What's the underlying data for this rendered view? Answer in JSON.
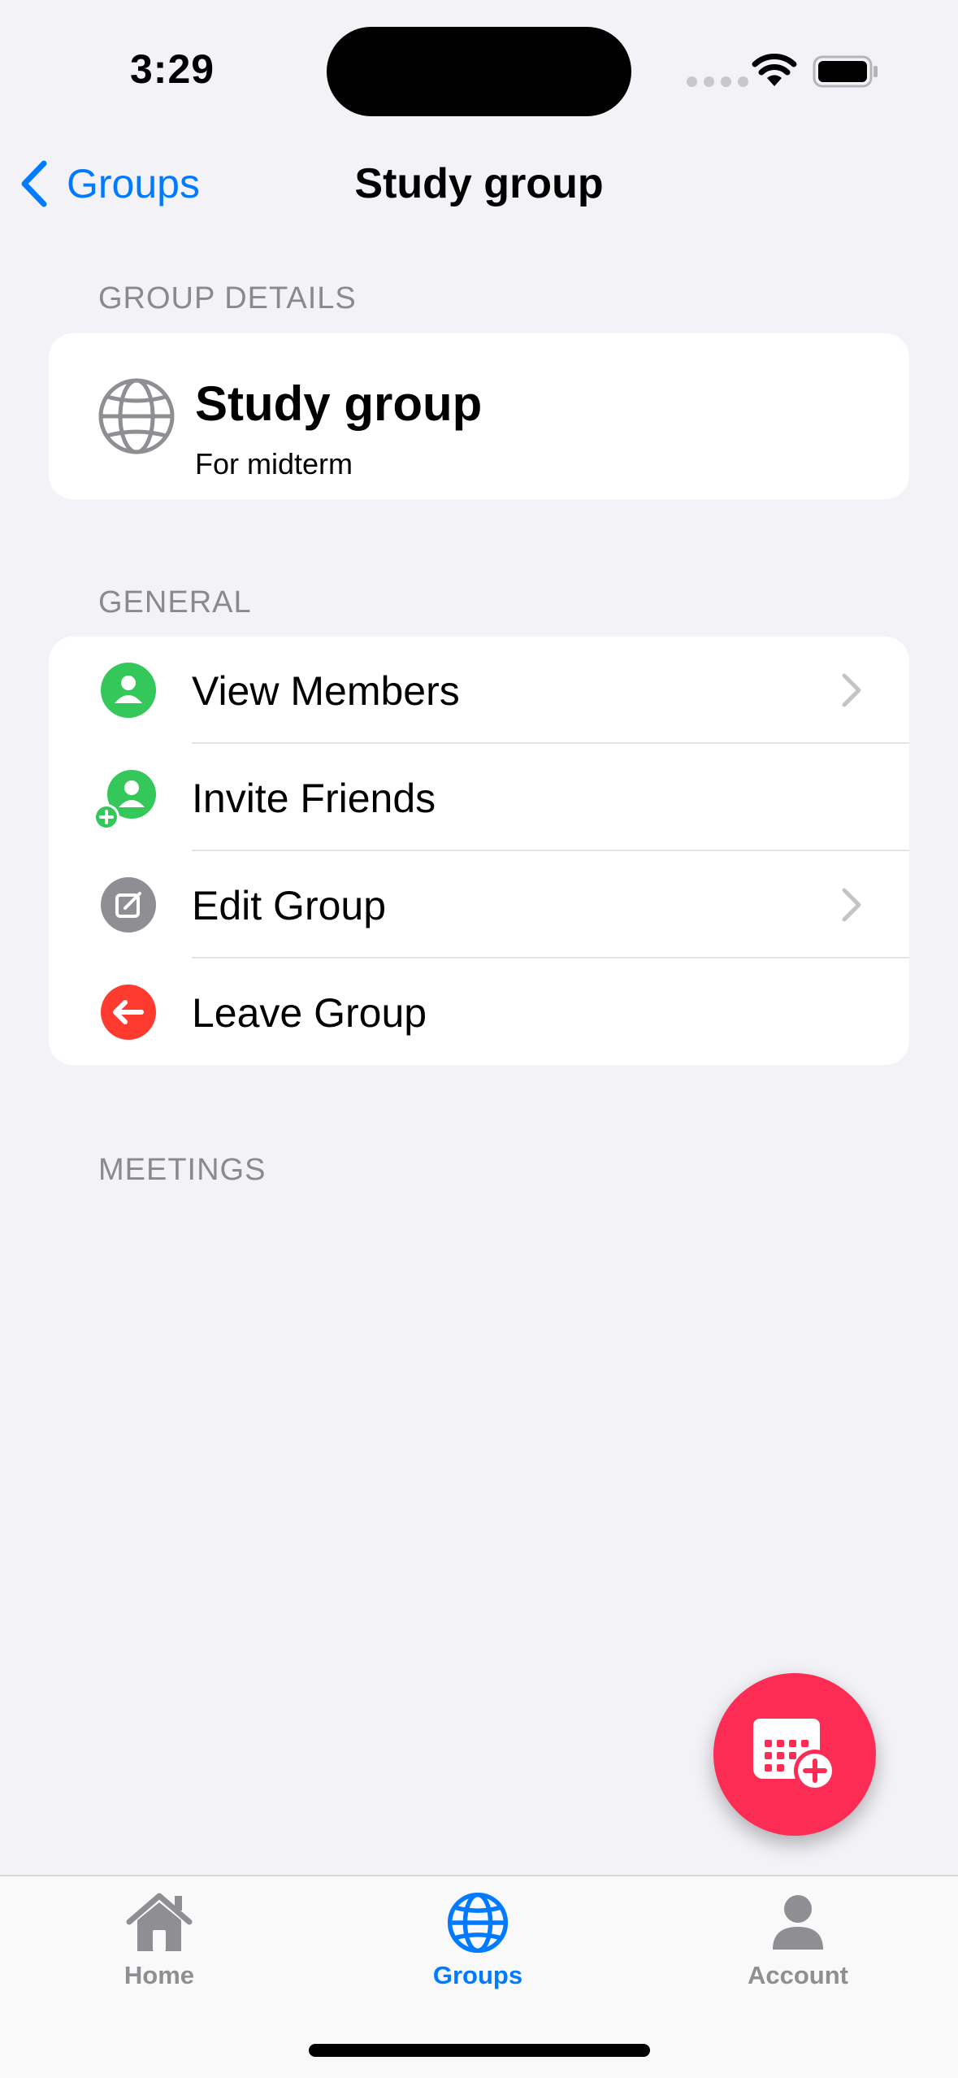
{
  "status_bar": {
    "time": "3:29"
  },
  "nav": {
    "back_label": "Groups",
    "title": "Study group"
  },
  "group_details": {
    "header": "GROUP DETAILS",
    "name": "Study group",
    "description": "For midterm",
    "icon": "globe-icon"
  },
  "general": {
    "header": "GENERAL",
    "items": [
      {
        "label": "View Members",
        "icon": "person-circle-icon",
        "color": "#34c759",
        "chevron": true
      },
      {
        "label": "Invite Friends",
        "icon": "person-add-icon",
        "color": "#34c759",
        "chevron": false
      },
      {
        "label": "Edit Group",
        "icon": "edit-icon",
        "color": "#8e8e93",
        "chevron": true
      },
      {
        "label": "Leave Group",
        "icon": "arrow-left-circle-icon",
        "color": "#ff3b30",
        "chevron": false
      }
    ]
  },
  "meetings": {
    "header": "MEETINGS"
  },
  "fab": {
    "icon": "calendar-add-icon",
    "color": "#fc2c55"
  },
  "tabbar": {
    "tabs": [
      {
        "label": "Home",
        "icon": "house-icon",
        "active": false
      },
      {
        "label": "Groups",
        "icon": "globe-icon",
        "active": true
      },
      {
        "label": "Account",
        "icon": "person-icon",
        "active": false
      }
    ],
    "active_color": "#007aff",
    "inactive_color": "#8e8e93"
  }
}
